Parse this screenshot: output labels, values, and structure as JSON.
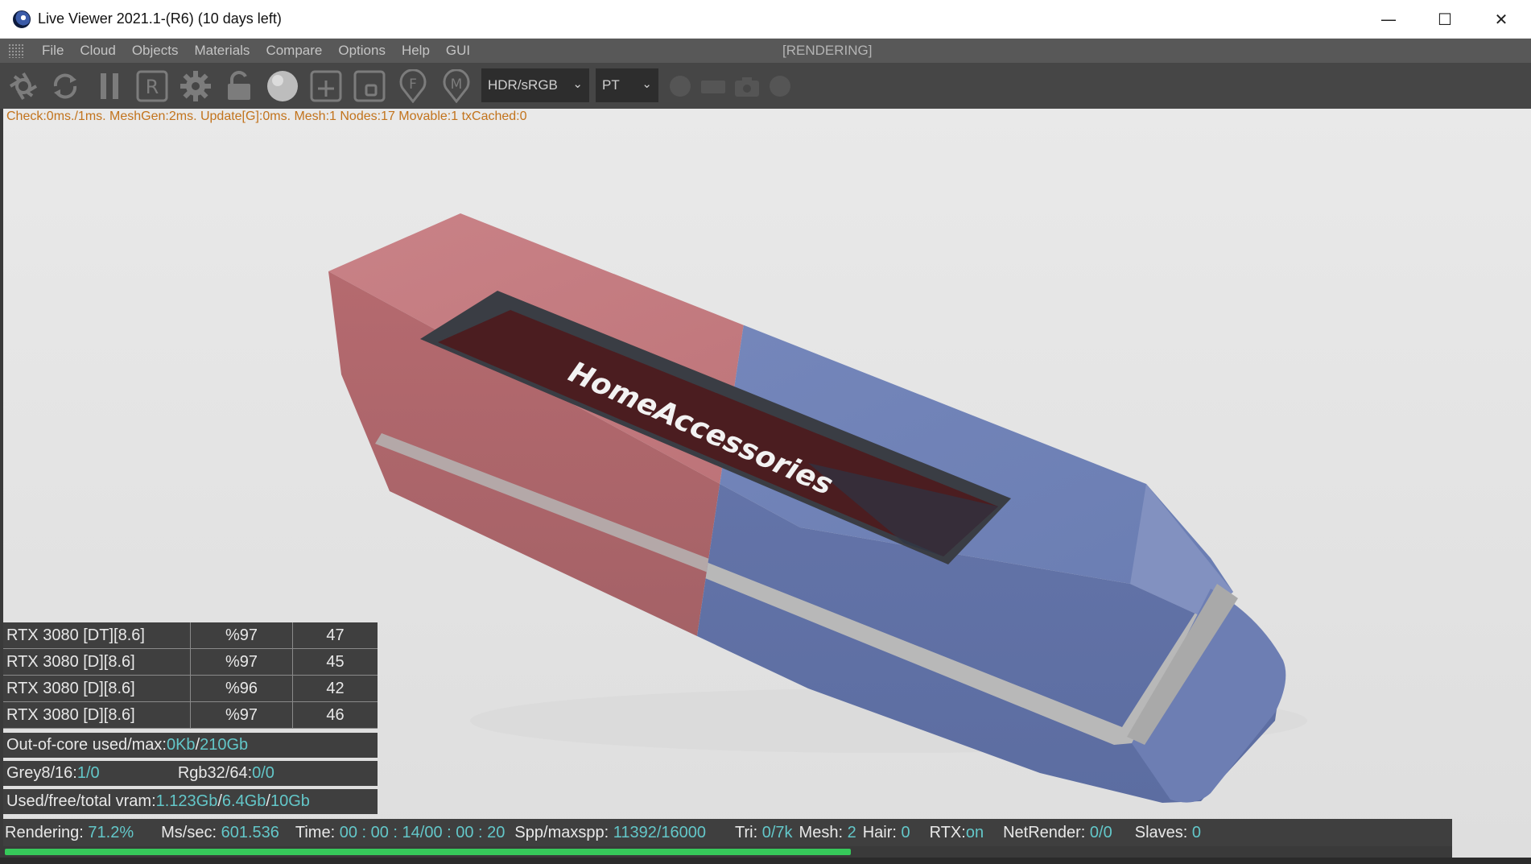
{
  "window": {
    "title": "Live Viewer 2021.1-(R6) (10 days left)",
    "controls": {
      "minimize": "—",
      "maximize": "☐",
      "close": "✕"
    }
  },
  "menu": {
    "items": [
      "File",
      "Cloud",
      "Objects",
      "Materials",
      "Compare",
      "Options",
      "Help",
      "GUI"
    ],
    "status": "[RENDERING]"
  },
  "toolbar": {
    "icons": [
      "aperture-icon",
      "refresh-icon",
      "pause-icon",
      "region-r-icon",
      "gear-icon",
      "lock-icon",
      "sphere-icon",
      "add-box-icon",
      "box-icon",
      "focus-pin-icon",
      "material-pin-icon"
    ],
    "r_label": "R",
    "f_label": "F",
    "m_label": "M",
    "colorspace": "HDR/sRGB",
    "kernel": "PT",
    "disabled_icons": [
      "dot-icon",
      "film-icon",
      "camera-icon",
      "circle-icon"
    ]
  },
  "debug": "Check:0ms./1ms. MeshGen:2ms. Update[G]:0ms. Mesh:1 Nodes:17 Movable:1 txCached:0",
  "scene": {
    "label": "HomeAccessories",
    "colors": {
      "red": "#c07478",
      "blue": "#7082b4",
      "stripe": "#b0b0b0",
      "inset": "#4a1c1e"
    }
  },
  "gpus": [
    {
      "name": "RTX 3080 [DT][8.6]",
      "util": "%97",
      "temp": "47"
    },
    {
      "name": "RTX 3080 [D][8.6]",
      "util": "%97",
      "temp": "45"
    },
    {
      "name": "RTX 3080 [D][8.6]",
      "util": "%96",
      "temp": "42"
    },
    {
      "name": "RTX 3080 [D][8.6]",
      "util": "%97",
      "temp": "46"
    }
  ],
  "memory": {
    "ooc_label": "Out-of-core used/max:",
    "ooc_used": "0Kb",
    "sep": "/",
    "ooc_max": "210Gb",
    "grey_label": "Grey8/16: ",
    "grey_value": "1/0",
    "rgb_label": "Rgb32/64: ",
    "rgb_value": "0/0",
    "vram_label": "Used/free/total vram: ",
    "vram_used": "1.123Gb",
    "vram_free": "6.4Gb",
    "vram_total": "10Gb"
  },
  "status": {
    "rendering_label": "Rendering: ",
    "rendering_value": "71.2%",
    "ms_label": "Ms/sec: ",
    "ms_value": "601.536",
    "time_label": "Time: ",
    "time_value": "00 : 00 : 14/00 : 00 : 20",
    "spp_label": "Spp/maxspp: ",
    "spp_value": "11392/16000",
    "tri_label": "Tri: ",
    "tri_value": "0/7k",
    "mesh_label": "Mesh: ",
    "mesh_value": "2",
    "hair_label": "Hair: ",
    "hair_value": "0",
    "rtx_label": "RTX:",
    "rtx_value": "on",
    "net_label": "NetRender: ",
    "net_value": "0/0",
    "slaves_label": "Slaves: ",
    "slaves_value": "0",
    "progress": 0.585
  }
}
